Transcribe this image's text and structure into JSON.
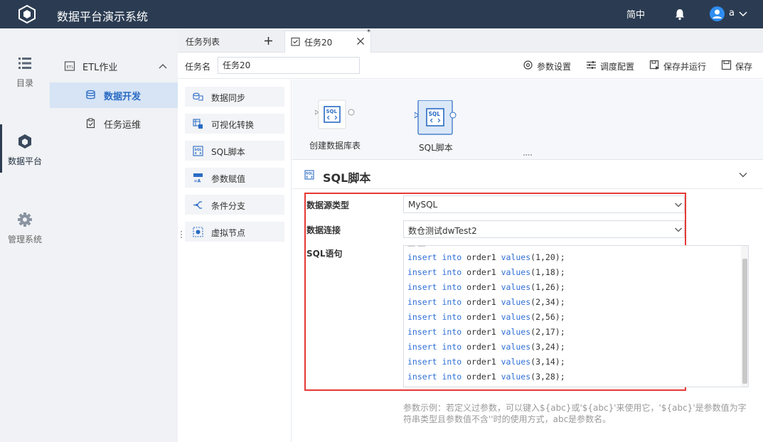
{
  "topbar": {
    "app_title": "数据平台演示系统",
    "lang": "简中",
    "user": "a",
    "icons": {
      "logo": "cube-logo",
      "bell": "bell-icon",
      "avatar": "user-avatar-icon",
      "caret": "chevron-down-icon"
    }
  },
  "leftnav": {
    "items": [
      {
        "label": "目录",
        "icon": "list-icon"
      },
      {
        "label": "数据平台",
        "icon": "cube-icon",
        "active": true
      },
      {
        "label": "管理系统",
        "icon": "gear-icon"
      }
    ]
  },
  "subnav": {
    "group_label": "ETL作业",
    "items": [
      {
        "label": "数据开发",
        "icon": "database-icon",
        "active": true
      },
      {
        "label": "任务运维",
        "icon": "clipboard-icon"
      }
    ]
  },
  "tabs": {
    "list_label": "任务列表",
    "task_label": "任务20",
    "modified_mark": "*"
  },
  "taskbar": {
    "name_label": "任务名",
    "name_value": "任务20",
    "actions": [
      {
        "label": "参数设置",
        "icon": "settings-icon"
      },
      {
        "label": "调度配置",
        "icon": "sliders-icon"
      },
      {
        "label": "保存并运行",
        "icon": "save-run-icon"
      },
      {
        "label": "保存",
        "icon": "save-icon"
      }
    ]
  },
  "palette": {
    "items": [
      {
        "label": "数据同步",
        "icon": "sync-icon"
      },
      {
        "label": "可视化转换",
        "icon": "transform-icon"
      },
      {
        "label": "SQL脚本",
        "icon": "sql-icon"
      },
      {
        "label": "参数赋值",
        "icon": "param-icon"
      },
      {
        "label": "条件分支",
        "icon": "branch-icon"
      },
      {
        "label": "虚拟节点",
        "icon": "virtual-node-icon"
      }
    ]
  },
  "canvas": {
    "nodes": [
      {
        "label": "创建数据库表",
        "icon_text": "SQL"
      },
      {
        "label": "SQL脚本",
        "icon_text": "SQL",
        "selected": true
      }
    ]
  },
  "props": {
    "title": "SQL脚本",
    "fields": {
      "datasource_type_label": "数据源类型",
      "datasource_type_value": "MySQL",
      "connection_label": "数据连接",
      "connection_value": "数仓测试dwTest2",
      "sql_label": "SQL语句"
    },
    "sql_lines": [
      "insert into order1 values(1,20);",
      "insert into order1 values(1,18);",
      "insert into order1 values(1,26);",
      "insert into order1 values(2,34);",
      "insert into order1 values(2,56);",
      "insert into order1 values(2,17);",
      "insert into order1 values(3,24);",
      "insert into order1 values(3,14);",
      "insert into order1 values(3,28);"
    ],
    "hint": "参数示例：若定义过参数，可以键入${abc}或'${abc}'来使用它，'${abc}'是参数值为字符串类型且参数值不含''时的使用方式，abc是参数名。"
  },
  "colors": {
    "topbar": "#2b3c52",
    "accent": "#2a6bc4",
    "highlight_box": "#e53935",
    "keyword": "#2f6fd6"
  }
}
